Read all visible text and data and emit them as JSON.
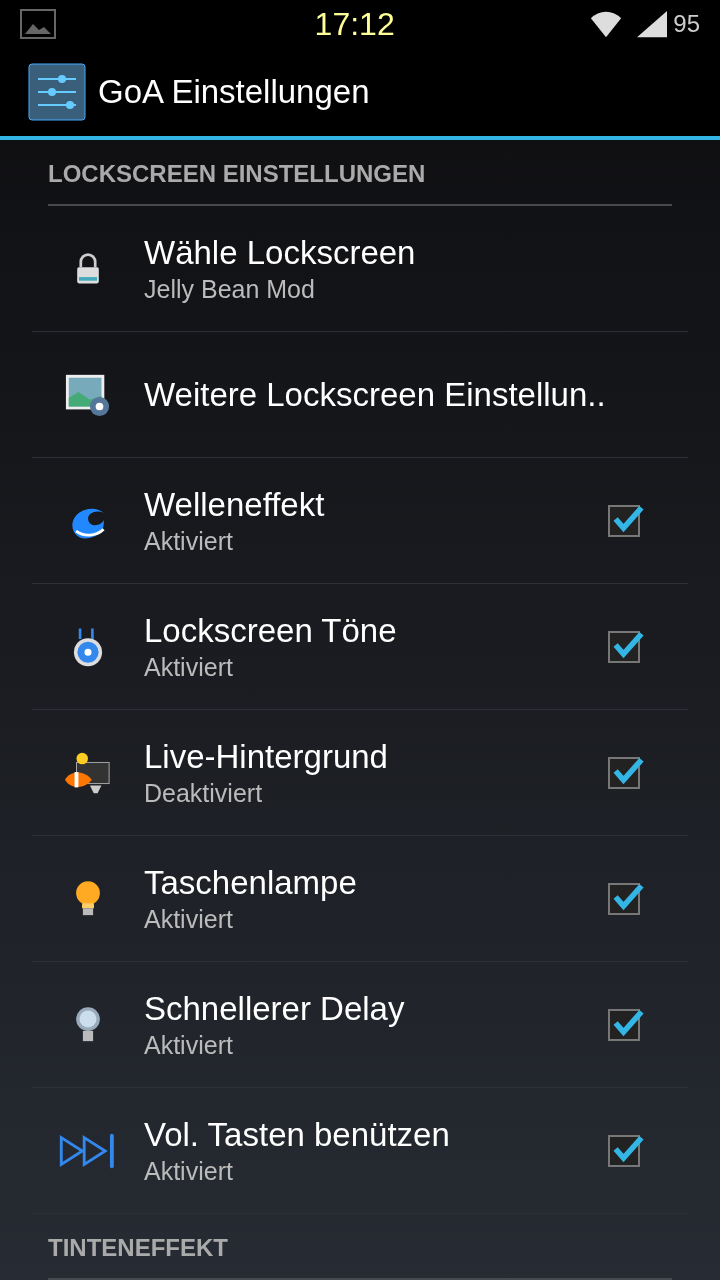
{
  "status_bar": {
    "time": "17:12",
    "battery": "95"
  },
  "action_bar": {
    "title": "GoA Einstellungen"
  },
  "sections": [
    {
      "title": "LOCKSCREEN EINSTELLUNGEN",
      "items": [
        {
          "kind": "list",
          "title": "Wähle Lockscreen",
          "summary": "Jelly Bean Mod"
        },
        {
          "kind": "list",
          "title": "Weitere Lockscreen Einstellun.."
        },
        {
          "kind": "checkbox",
          "title": "Welleneffekt",
          "summary": "Aktiviert",
          "checked": true
        },
        {
          "kind": "checkbox",
          "title": "Lockscreen Töne",
          "summary": "Aktiviert",
          "checked": true
        },
        {
          "kind": "checkbox",
          "title": "Live-Hintergrund",
          "summary": "Deaktiviert",
          "checked": true
        },
        {
          "kind": "checkbox",
          "title": "Taschenlampe",
          "summary": "Aktiviert",
          "checked": true
        },
        {
          "kind": "checkbox",
          "title": "Schnellerer Delay",
          "summary": "Aktiviert",
          "checked": true
        },
        {
          "kind": "checkbox",
          "title": "Vol. Tasten benützen",
          "summary": "Aktiviert",
          "checked": true
        }
      ]
    },
    {
      "title": "TINTENEFFEKT"
    }
  ]
}
